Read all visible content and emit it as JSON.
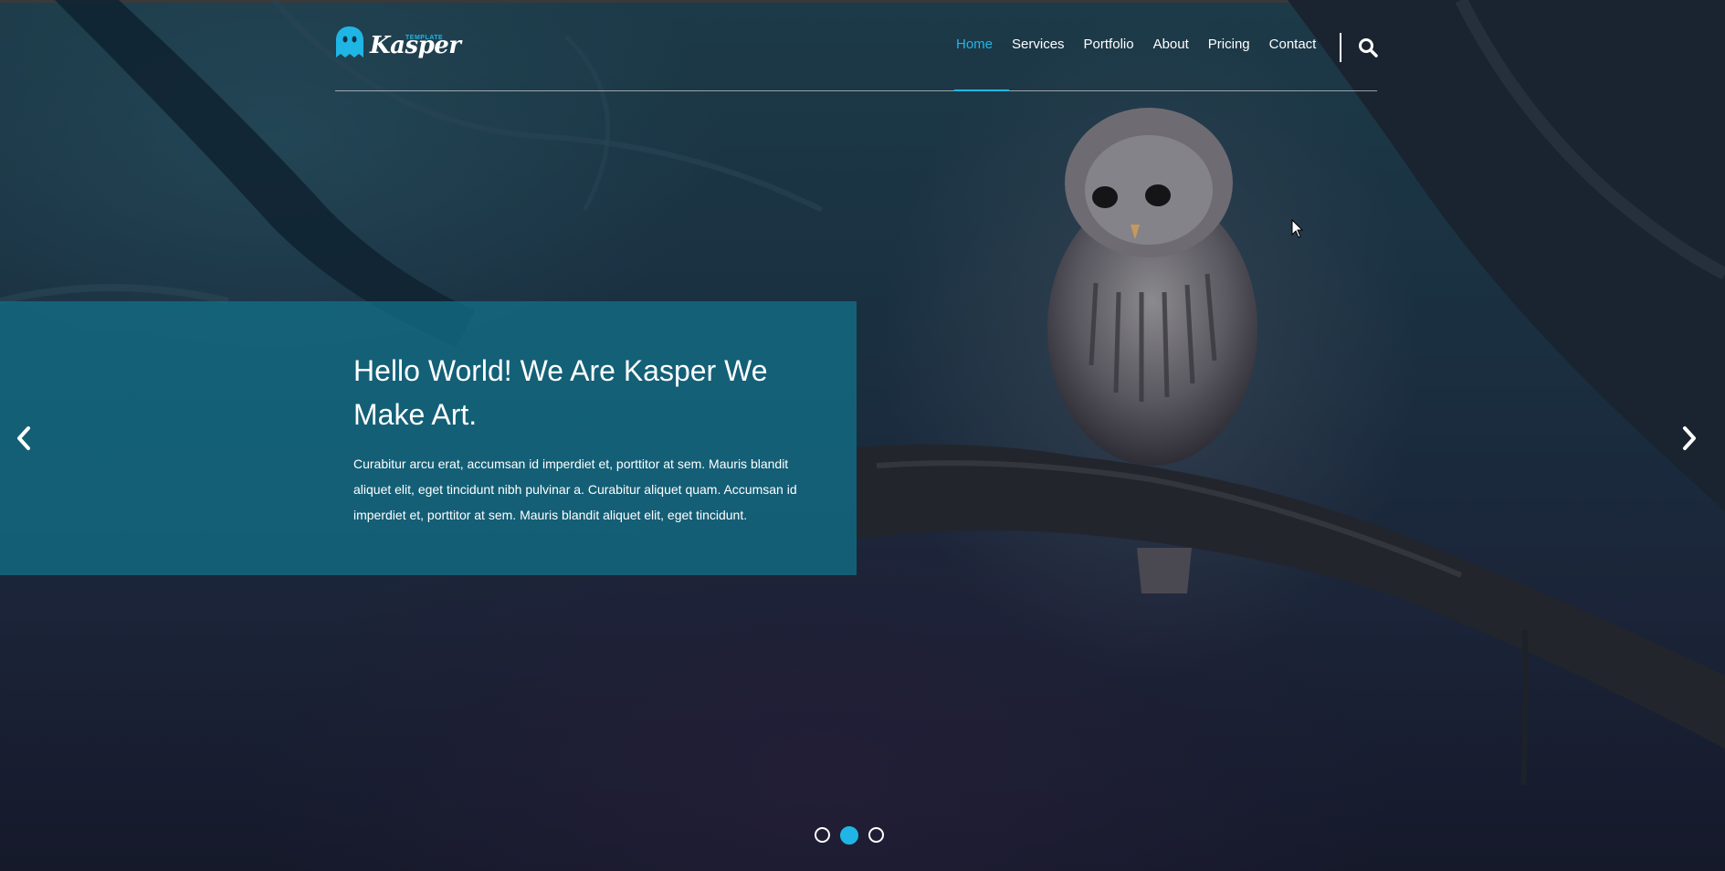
{
  "brand": {
    "name": "Kasper",
    "tagline": "TEMPLATE",
    "accent_color": "#1fb6e6",
    "logo_icon": "ghost-icon"
  },
  "nav": {
    "items": [
      {
        "label": "Home",
        "active": true
      },
      {
        "label": "Services",
        "active": false
      },
      {
        "label": "Portfolio",
        "active": false
      },
      {
        "label": "About",
        "active": false
      },
      {
        "label": "Pricing",
        "active": false
      },
      {
        "label": "Contact",
        "active": false
      }
    ],
    "search_icon": "search-icon"
  },
  "slider": {
    "heading": "Hello World! We Are Kasper We Make Art.",
    "text": "Curabitur arcu erat, accumsan id imperdiet et, porttitor at sem. Mauris blandit aliquet elit, eget tincidunt nibh pulvinar a. Curabitur aliquet quam. Accumsan id imperdiet et, porttitor at sem. Mauris blandit aliquet elit, eget tincidunt.",
    "prev_icon": "chevron-left-icon",
    "next_icon": "chevron-right-icon",
    "slide_count": 3,
    "active_slide": 2,
    "caption_bg": "#126e87"
  }
}
